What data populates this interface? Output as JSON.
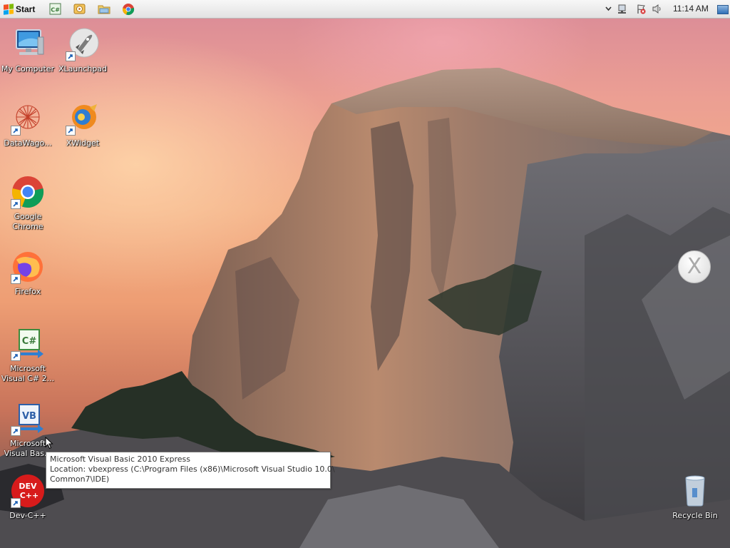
{
  "taskbar": {
    "start_label": "Start",
    "quick_launch": [
      {
        "name": "visual-csharp-quick-icon"
      },
      {
        "name": "media-player-quick-icon"
      },
      {
        "name": "file-explorer-quick-icon"
      },
      {
        "name": "chrome-quick-icon"
      }
    ],
    "tray": {
      "icons": [
        "chevron-up-icon",
        "network-icon",
        "action-center-flag-icon",
        "volume-icon"
      ],
      "clock": "11:14 AM"
    }
  },
  "desktop": {
    "icons": [
      {
        "label": "My Computer",
        "icon": "computer-icon",
        "shortcut": false
      },
      {
        "label": "XLaunchpad",
        "icon": "rocket-icon",
        "shortcut": true
      },
      {
        "label": "DataWago...",
        "icon": "datawagon-icon",
        "shortcut": true
      },
      {
        "label": "XWidget",
        "icon": "xwidget-icon",
        "shortcut": true
      },
      {
        "label": "Google Chrome",
        "icon": "chrome-icon",
        "shortcut": true
      },
      {
        "label": "Firefox",
        "icon": "firefox-icon",
        "shortcut": true
      },
      {
        "label": "Microsoft Visual C# 2...",
        "icon": "visual-csharp-icon",
        "shortcut": true
      },
      {
        "label": "Microsoft Visual Bas...",
        "icon": "visual-basic-icon",
        "shortcut": true
      },
      {
        "label": "Dev-C++",
        "icon": "devcpp-icon",
        "shortcut": true
      },
      {
        "label": "Recycle Bin",
        "icon": "recycle-bin-icon",
        "shortcut": false
      }
    ],
    "overlay_x_label": "X",
    "devcpp_badge": {
      "line1": "DEV",
      "line2": "C++"
    }
  },
  "tooltip": {
    "title": "Microsoft Visual Basic 2010 Express",
    "line2": "Location: vbexpress (C:\\Program Files (x86)\\Microsoft Visual Studio 10.0\\",
    "line3": "Common7\\IDE)"
  },
  "colors": {
    "sky_top": "#d98a98",
    "sky_glow": "#f2ad86",
    "taskbar": "#ececec",
    "tooltip_bg": "#ffffff"
  }
}
